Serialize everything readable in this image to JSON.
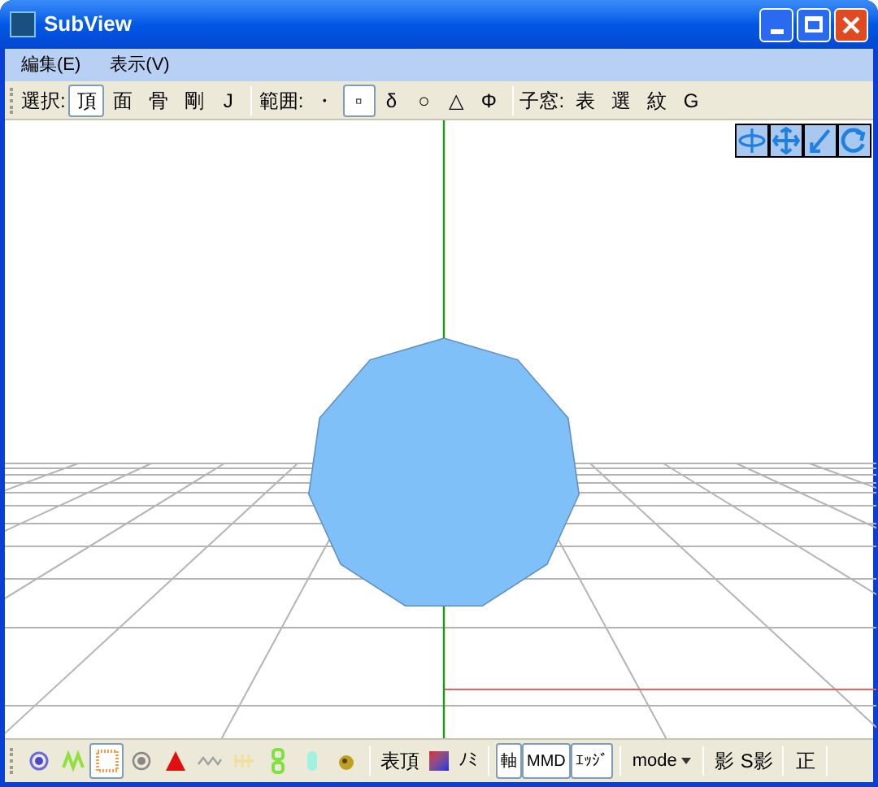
{
  "window": {
    "title": "SubView"
  },
  "menu": [
    "編集(E)",
    "表示(V)"
  ],
  "toolbar": [
    {
      "label": "選択:",
      "items": [
        {
          "text": "頂",
          "selected": true
        },
        {
          "text": "面",
          "selected": false
        },
        {
          "text": "骨",
          "selected": false
        },
        {
          "text": "剛",
          "selected": false
        },
        {
          "text": "J",
          "selected": false
        }
      ]
    },
    {
      "label": "範囲:",
      "items": [
        {
          "text": "・",
          "selected": false
        },
        {
          "text": "▫",
          "selected": true
        },
        {
          "text": "δ",
          "selected": false
        },
        {
          "text": "○",
          "selected": false
        },
        {
          "text": "△",
          "selected": false
        },
        {
          "text": "Φ",
          "selected": false
        }
      ]
    },
    {
      "label": "子窓:",
      "items": [
        {
          "text": "表",
          "selected": false
        },
        {
          "text": "選",
          "selected": false
        },
        {
          "text": "紋",
          "selected": false
        },
        {
          "text": "G",
          "selected": false
        }
      ]
    }
  ],
  "bottom_toolbar": {
    "icon_buttons": [
      {
        "selected": false
      },
      {
        "selected": false
      },
      {
        "selected": true
      },
      {
        "selected": false
      },
      {
        "selected": false
      },
      {
        "selected": false
      },
      {
        "selected": false
      },
      {
        "selected": false
      },
      {
        "selected": false
      },
      {
        "selected": false
      }
    ],
    "display_label": "表頂",
    "noise_label": "ﾉﾐ",
    "toggles": [
      {
        "text": "軸",
        "selected": true
      },
      {
        "text": "MMD",
        "selected": true
      },
      {
        "text": "ｴｯｼﾞ",
        "selected": true
      }
    ],
    "mode": "mode",
    "shadow_buttons": [
      "影",
      "S影"
    ],
    "front_button": "正"
  }
}
